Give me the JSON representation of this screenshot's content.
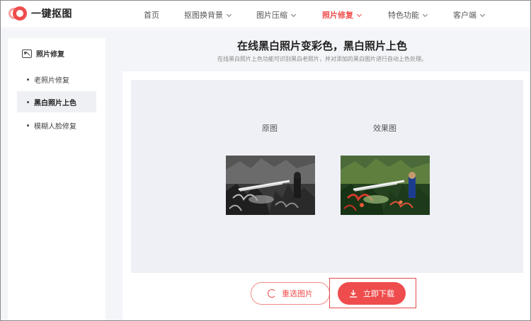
{
  "brand": {
    "name": "一键抠图",
    "accent": "#ef4d4d"
  },
  "nav": {
    "items": [
      {
        "label": "首页",
        "has_dropdown": false,
        "active": false
      },
      {
        "label": "抠图换背景",
        "has_dropdown": true,
        "active": false
      },
      {
        "label": "图片压缩",
        "has_dropdown": true,
        "active": false
      },
      {
        "label": "照片修复",
        "has_dropdown": true,
        "active": true
      },
      {
        "label": "特色功能",
        "has_dropdown": true,
        "active": false
      },
      {
        "label": "客户端",
        "has_dropdown": true,
        "active": false
      }
    ]
  },
  "sidebar": {
    "heading": "照片修复",
    "heading_icon": "image-icon",
    "items": [
      {
        "label": "老照片修复",
        "active": false
      },
      {
        "label": "黑白照片上色",
        "active": true
      },
      {
        "label": "模糊人脸修复",
        "active": false
      }
    ]
  },
  "main": {
    "title": "在线黑白照片变彩色，黑白照片上色",
    "subtitle": "在线黑白照片上色功能可识别黑白老照片，并对添加的黑白图片进行自动上色处理。",
    "original_label": "原图",
    "result_label": "效果图"
  },
  "actions": {
    "reselect_label": "重选图片",
    "reselect_icon": "refresh-icon",
    "download_label": "立即下载",
    "download_icon": "download-icon"
  }
}
